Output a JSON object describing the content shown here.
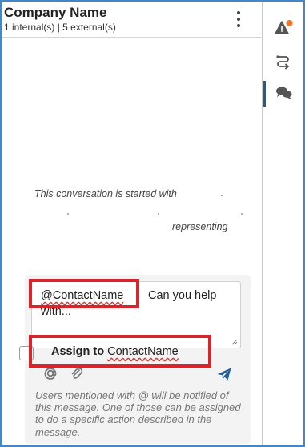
{
  "header": {
    "title": "Company Name",
    "subtitle": "1 internal(s) | 5 external(s)",
    "menu_icon": "kebab-menu-icon"
  },
  "conversation": {
    "started_text": "This conversation is started with",
    "representing_text": "representing"
  },
  "composer": {
    "mention": "@ContactName",
    "message_rest": "Can you help",
    "message_line2": "with...",
    "assign_label": "Assign to",
    "assign_name": "ContactName",
    "tools": [
      "at-sign-icon",
      "paperclip-icon",
      "send-icon"
    ],
    "hint": "Users mentioned with @ will be notified of this message. One of those can be assigned to do a specific action described in the message."
  },
  "rail": {
    "items": [
      {
        "icon": "warning-alert-icon",
        "active": false
      },
      {
        "icon": "route-icon",
        "active": false
      },
      {
        "icon": "chat-bubbles-icon",
        "active": true
      }
    ]
  },
  "colors": {
    "frame_border": "#3f89c9",
    "highlight": "#d9242b",
    "notification_dot": "#e8762d",
    "send_icon": "#1f5f96",
    "active_rail_bar": "#1e5f8f"
  }
}
